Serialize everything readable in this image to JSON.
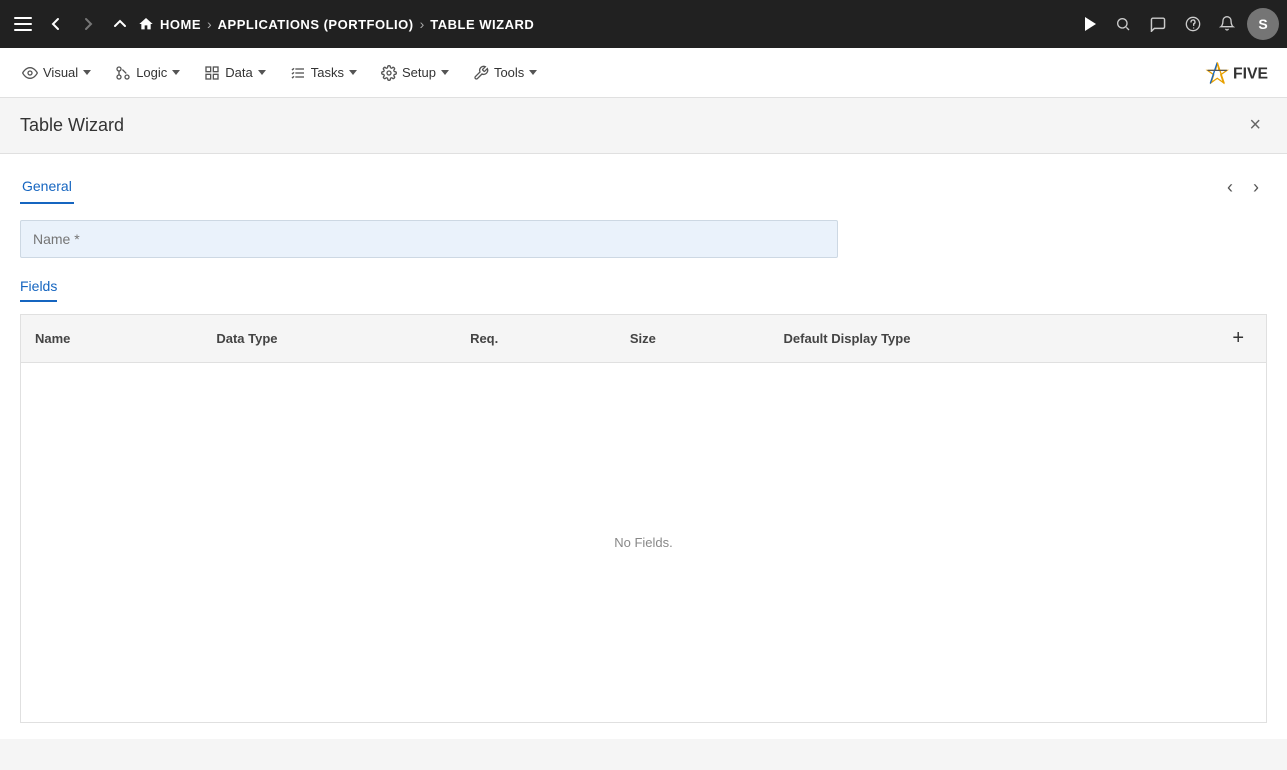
{
  "topNav": {
    "breadcrumbs": [
      {
        "id": "home",
        "label": "HOME",
        "icon": "🏠"
      },
      {
        "id": "applications",
        "label": "APPLICATIONS (PORTFOLIO)"
      },
      {
        "id": "table-wizard",
        "label": "TABLE WIZARD"
      }
    ],
    "buttons": {
      "menu": "☰",
      "back": "←",
      "forward": "→",
      "up": "↑",
      "play": "▶",
      "search": "🔍",
      "chat": "💬",
      "help": "?",
      "notifications": "🔔",
      "avatar": "S"
    }
  },
  "toolbar": {
    "items": [
      {
        "id": "visual",
        "label": "Visual",
        "icon": "👁",
        "hasDropdown": true
      },
      {
        "id": "logic",
        "label": "Logic",
        "icon": "⚙",
        "hasDropdown": true
      },
      {
        "id": "data",
        "label": "Data",
        "icon": "⊞",
        "hasDropdown": true
      },
      {
        "id": "tasks",
        "label": "Tasks",
        "icon": "≡",
        "hasDropdown": true
      },
      {
        "id": "setup",
        "label": "Setup",
        "icon": "⚙",
        "hasDropdown": true
      },
      {
        "id": "tools",
        "label": "Tools",
        "icon": "🔧",
        "hasDropdown": true
      }
    ]
  },
  "panel": {
    "title": "Table Wizard",
    "close_label": "×",
    "tabs": {
      "general": {
        "label": "General",
        "active": true
      },
      "fields": {
        "label": "Fields"
      }
    },
    "nav_prev": "‹",
    "nav_next": "›",
    "name_field": {
      "label": "Name *",
      "placeholder": "Name *",
      "value": ""
    },
    "fields_section": {
      "tab_label": "Fields",
      "columns": [
        {
          "id": "name",
          "label": "Name"
        },
        {
          "id": "data-type",
          "label": "Data Type"
        },
        {
          "id": "req",
          "label": "Req."
        },
        {
          "id": "size",
          "label": "Size"
        },
        {
          "id": "default-display-type",
          "label": "Default Display Type"
        }
      ],
      "add_button": "+",
      "empty_message": "No Fields."
    }
  },
  "logo": {
    "text": "FIVE",
    "alt": "Five Logo"
  }
}
